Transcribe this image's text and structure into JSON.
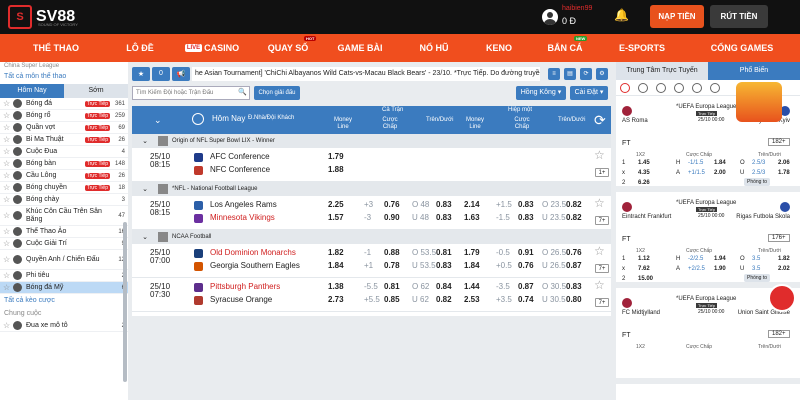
{
  "header": {
    "logo": "SV88",
    "tagline": "SOUND OF VICTORY",
    "username": "haibien99",
    "balance": "0 Đ",
    "deposit_label": "NẠP TIỀN",
    "withdraw_label": "RÚT TIỀN"
  },
  "nav": {
    "items": [
      "THỂ THAO",
      "LÔ ĐỀ",
      "CASINO",
      "QUAY SỐ",
      "GAME BÀI",
      "NỔ HŨ",
      "KENO",
      "BẮN CÁ",
      "E-SPORTS",
      "CỔNG GAMES"
    ],
    "live_tag": "LIVE",
    "hot_badge": "HOT",
    "new_badge": "NEW"
  },
  "sidebar": {
    "league_top": "China Super League",
    "all_sports": "Tất cả môn thể thao",
    "tab_today": "Hôm Nay",
    "tab_early": "Sớm",
    "sports": [
      {
        "label": "Bóng đá",
        "live": "Trực Tiếp",
        "count": "361"
      },
      {
        "label": "Bóng rổ",
        "live": "Trực Tiếp",
        "count": "259"
      },
      {
        "label": "Quần vợt",
        "live": "Trực Tiếp",
        "count": "69"
      },
      {
        "label": "Bi Ma Thuật",
        "live": "Trực Tiếp",
        "count": "26"
      },
      {
        "label": "Cuộc Đua",
        "live": "",
        "count": "4"
      },
      {
        "label": "Bóng bàn",
        "live": "Trực Tiếp",
        "count": "148"
      },
      {
        "label": "Cầu Lông",
        "live": "Trực Tiếp",
        "count": "26"
      },
      {
        "label": "Bóng chuyền",
        "live": "Trực Tiếp",
        "count": "18"
      },
      {
        "label": "Bóng chày",
        "live": "",
        "count": "3"
      },
      {
        "label": "Khúc Côn Cầu Trên Sân Băng",
        "live": "",
        "count": "47"
      },
      {
        "label": "Thể Thao Ảo",
        "live": "",
        "count": "16"
      },
      {
        "label": "Cuộc Giải Trí",
        "live": "",
        "count": "9"
      },
      {
        "label": "Quyền Anh / Chiến Đấu",
        "live": "",
        "count": "12"
      },
      {
        "label": "Phi tiêu",
        "live": "",
        "count": "2"
      },
      {
        "label": "Bóng đá Mỹ",
        "live": "",
        "count": "6"
      }
    ],
    "all_bet_types": "Tất cả kèo cược",
    "final": "Chung cuộc",
    "last_item": "Đua xe mô tô",
    "last_count": "2"
  },
  "toolbar": {
    "marquee": "he Asian Tournament] 'ChiChi Albayanos Wild Cats-vs-Macau Black Bears' - 23/10. *Trực Tiếp. Do đường truyền g"
  },
  "search": {
    "placeholder": "Tìm Kiếm Đội hoặc Trận Đấu",
    "pick_button": "Chọn giải đấu",
    "odds_type": "Hồng Kông",
    "sort": "Cài Đặt"
  },
  "table": {
    "header": {
      "today": "Hôm Nay",
      "home_away": "Đ.Nhà/Đội Khách",
      "full_time": "Cả Trận",
      "half_time": "Hiệp một",
      "money_line": "Money Line",
      "handicap": "Cược Chấp",
      "over_under": "Trên/Dưới"
    },
    "leagues": [
      {
        "name": "Origin of NFL Super Bowl LIX - Winner",
        "matches": [
          {
            "date": "25/10",
            "time": "08:15",
            "home": "AFC Conference",
            "away": "NFC Conference",
            "ml": [
              "1.79",
              "1.88"
            ],
            "hdp_line": [
              "",
              ""
            ],
            "hdp_odds": [
              "",
              ""
            ],
            "ou_line": [
              "",
              ""
            ],
            "ou_odds": [
              "",
              ""
            ],
            "h1_ml": [
              "",
              ""
            ],
            "h1_hdp_line": [
              "",
              ""
            ],
            "h1_hdp_odds": [
              "",
              ""
            ],
            "h1_ou_line": [
              "",
              ""
            ],
            "h1_ou_odds": [
              "",
              ""
            ],
            "more": "1+"
          }
        ]
      },
      {
        "name": "*NFL - National Football League",
        "matches": [
          {
            "date": "25/10",
            "time": "08:15",
            "home": "Los Angeles Rams",
            "away": "Minnesota Vikings",
            "ml": [
              "2.25",
              "1.57"
            ],
            "hdp_line": [
              "+3",
              "-3"
            ],
            "hdp_odds": [
              "0.76",
              "0.90"
            ],
            "ou_line": [
              "O 48",
              "U 48"
            ],
            "ou_odds": [
              "0.83",
              "0.83"
            ],
            "h1_ml": [
              "2.14",
              "1.63"
            ],
            "h1_hdp_line": [
              "+1.5",
              "-1.5"
            ],
            "h1_hdp_odds": [
              "0.83",
              "0.83"
            ],
            "h1_ou_line": [
              "O 23.5",
              "U 23.5"
            ],
            "h1_ou_odds": [
              "0.82",
              "0.82"
            ],
            "more": "7+"
          }
        ]
      },
      {
        "name": "NCAA Football",
        "matches": [
          {
            "date": "25/10",
            "time": "07:00",
            "home": "Old Dominion Monarchs",
            "away": "Georgia Southern Eagles",
            "ml": [
              "1.82",
              "1.84"
            ],
            "hdp_line": [
              "-1",
              "+1"
            ],
            "hdp_odds": [
              "0.88",
              "0.78"
            ],
            "ou_line": [
              "O 53.5",
              "U 53.5"
            ],
            "ou_odds": [
              "0.81",
              "0.83"
            ],
            "h1_ml": [
              "1.79",
              "1.84"
            ],
            "h1_hdp_line": [
              "-0.5",
              "+0.5"
            ],
            "h1_hdp_odds": [
              "0.91",
              "0.76"
            ],
            "h1_ou_line": [
              "O 26.5",
              "U 26.5"
            ],
            "h1_ou_odds": [
              "0.76",
              "0.87"
            ],
            "more": "7+"
          },
          {
            "date": "25/10",
            "time": "07:30",
            "home": "Pittsburgh Panthers",
            "away": "Syracuse Orange",
            "ml": [
              "1.38",
              "2.73"
            ],
            "hdp_line": [
              "-5.5",
              "+5.5"
            ],
            "hdp_odds": [
              "0.81",
              "0.85"
            ],
            "ou_line": [
              "O 62",
              "U 62"
            ],
            "ou_odds": [
              "0.84",
              "0.82"
            ],
            "h1_ml": [
              "1.44",
              "2.53"
            ],
            "h1_hdp_line": [
              "-3.5",
              "+3.5"
            ],
            "h1_hdp_odds": [
              "0.87",
              "0.74"
            ],
            "h1_ou_line": [
              "O 30.5",
              "U 30.5"
            ],
            "h1_ou_odds": [
              "0.83",
              "0.80"
            ],
            "more": "7+"
          }
        ]
      }
    ]
  },
  "right_panel": {
    "tab_live": "Trung Tâm Trực Tuyến",
    "tab_featured": "Phổ Biến",
    "matches": [
      {
        "comp": "*UEFA Europa League",
        "live": "Trực Tiếp",
        "date": "25/10",
        "time": "00:00",
        "home": "AS Roma",
        "away": "Dynamo Kyiv",
        "more": "182+",
        "hdr": [
          "1X2",
          "Cược Chấp",
          "Trên/Dưới"
        ],
        "rows": [
          [
            "1",
            "1.45",
            "H",
            "-1/1.5",
            "1.84",
            "O",
            "2.5/3",
            "2.06"
          ],
          [
            "x",
            "4.35",
            "A",
            "+1/1.5",
            "2.00",
            "U",
            "2.5/3",
            "1.78"
          ],
          [
            "2",
            "6.26",
            "",
            "",
            "",
            "",
            "",
            ""
          ]
        ],
        "phong_to": "Phóng to"
      },
      {
        "comp": "*UEFA Europa League",
        "live": "Trực Tiếp",
        "date": "25/10",
        "time": "00:00",
        "home": "Eintracht Frankfurt",
        "away": "Rigas Futbola Skola",
        "more": "176+",
        "hdr": [
          "1X2",
          "Cược Chấp",
          "Trên/Dưới"
        ],
        "rows": [
          [
            "1",
            "1.12",
            "H",
            "-2/2.5",
            "1.94",
            "O",
            "3.5",
            "1.82"
          ],
          [
            "x",
            "7.62",
            "A",
            "+2/2.5",
            "1.90",
            "U",
            "3.5",
            "2.02"
          ],
          [
            "2",
            "15.00",
            "",
            "",
            "",
            "",
            "",
            ""
          ]
        ],
        "phong_to": "Phóng to"
      },
      {
        "comp": "*UEFA Europa League",
        "live": "Trực Tiếp",
        "date": "25/10",
        "time": "00:00",
        "home": "FC Midtjylland",
        "away": "Union Saint Gilloise",
        "more": "182+",
        "hdr": [
          "1X2",
          "Cược Chấp",
          "Trên/Dưới"
        ],
        "rows": [],
        "phong_to": ""
      }
    ]
  },
  "colors": {
    "accent": "#f04e1e",
    "primary": "#3b7bbf",
    "header_bg": "#111111",
    "live_red": "#e02c2c"
  }
}
